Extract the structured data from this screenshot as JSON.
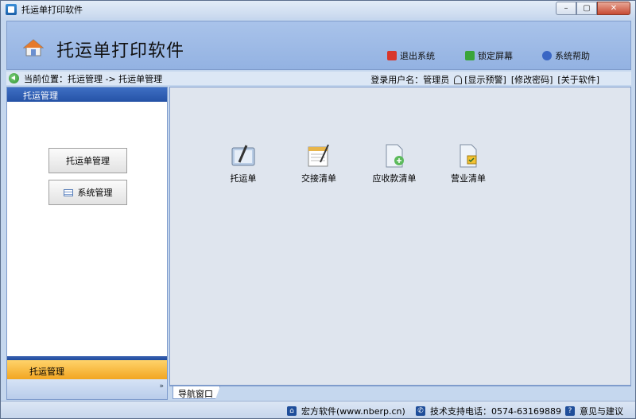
{
  "window": {
    "title": "托运单打印软件",
    "minimize": "–",
    "maximize": "▢",
    "close": "✕"
  },
  "header": {
    "title": "托运单打印软件",
    "links": [
      {
        "label": "退出系统",
        "color": "#d9362b"
      },
      {
        "label": "锁定屏幕",
        "color": "#3aa53a"
      },
      {
        "label": "系统帮助",
        "color": "#3a66c4"
      }
    ]
  },
  "breadcrumb": {
    "text": "当前位置：托运管理 -> 托运单管理"
  },
  "userbar": {
    "user_label": "登录用户名：管理员",
    "show_alarm": "[显示预警]",
    "change_password": "[修改密码]",
    "about": "[关于软件]"
  },
  "sidebar": {
    "header": "托运管理",
    "buttons": [
      {
        "label": "托运单管理"
      },
      {
        "label": "系统管理"
      }
    ],
    "active_tab": "托运管理",
    "expand": "»"
  },
  "main": {
    "items": [
      {
        "label": "托运单"
      },
      {
        "label": "交接清单"
      },
      {
        "label": "应收款清单"
      },
      {
        "label": "营业清单"
      }
    ],
    "tab": "导航窗口"
  },
  "statusbar": {
    "company": "宏方软件(www.nberp.cn)",
    "phone": "技术支持电话：0574-63169889",
    "feedback": "意见与建议"
  }
}
